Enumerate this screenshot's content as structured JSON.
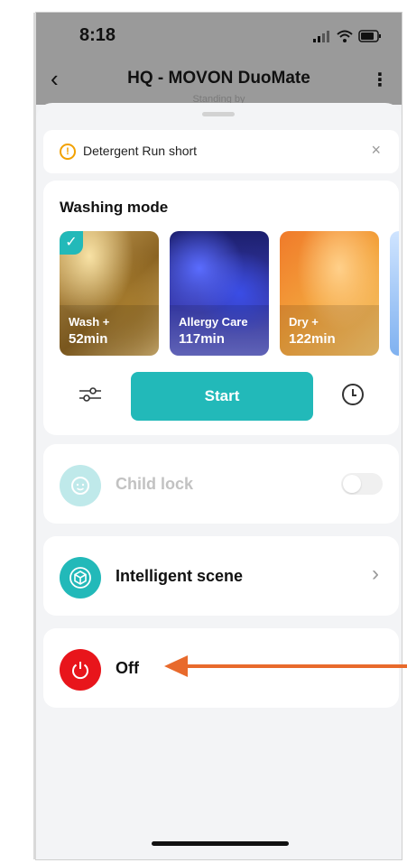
{
  "statusbar": {
    "time": "8:18"
  },
  "header": {
    "title": "HQ  - MOVON DuoMate",
    "subtitle": "Standing by"
  },
  "notice": {
    "text": "Detergent Run short"
  },
  "washing": {
    "title": "Washing mode",
    "modes": [
      {
        "name": "Wash +",
        "time": "52min",
        "selected": true
      },
      {
        "name": "Allergy Care",
        "time": "117min"
      },
      {
        "name": "Dry +",
        "time": "122min"
      }
    ],
    "start_label": "Start"
  },
  "child_lock": {
    "label": "Child lock",
    "enabled": false
  },
  "scene": {
    "label": "Intelligent scene"
  },
  "power": {
    "label": "Off"
  },
  "colors": {
    "accent": "#22b9b9",
    "power": "#e8151b",
    "annotation_arrow": "#e86a2c"
  }
}
